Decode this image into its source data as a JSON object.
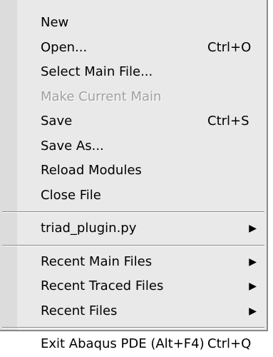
{
  "menu": {
    "group1": [
      {
        "label": "New",
        "shortcut": "",
        "disabled": false,
        "submenu": false
      },
      {
        "label": "Open...",
        "shortcut": "Ctrl+O",
        "disabled": false,
        "submenu": false
      },
      {
        "label": "Select Main File...",
        "shortcut": "",
        "disabled": false,
        "submenu": false
      },
      {
        "label": "Make Current Main",
        "shortcut": "",
        "disabled": true,
        "submenu": false
      },
      {
        "label": "Save",
        "shortcut": "Ctrl+S",
        "disabled": false,
        "submenu": false
      },
      {
        "label": "Save As...",
        "shortcut": "",
        "disabled": false,
        "submenu": false
      },
      {
        "label": "Reload Modules",
        "shortcut": "",
        "disabled": false,
        "submenu": false
      },
      {
        "label": "Close File",
        "shortcut": "",
        "disabled": false,
        "submenu": false
      }
    ],
    "group2": [
      {
        "label": "triad_plugin.py",
        "shortcut": "",
        "disabled": false,
        "submenu": true
      }
    ],
    "group3": [
      {
        "label": "Recent Main Files",
        "shortcut": "",
        "disabled": false,
        "submenu": true
      },
      {
        "label": "Recent Traced Files",
        "shortcut": "",
        "disabled": false,
        "submenu": true
      },
      {
        "label": "Recent Files",
        "shortcut": "",
        "disabled": false,
        "submenu": true
      }
    ],
    "group4": [
      {
        "label": "Exit Abaqus PDE (Alt+F4)",
        "shortcut": "Ctrl+Q",
        "disabled": false,
        "submenu": false
      }
    ],
    "submenu_icon": "triangle-right-icon"
  }
}
